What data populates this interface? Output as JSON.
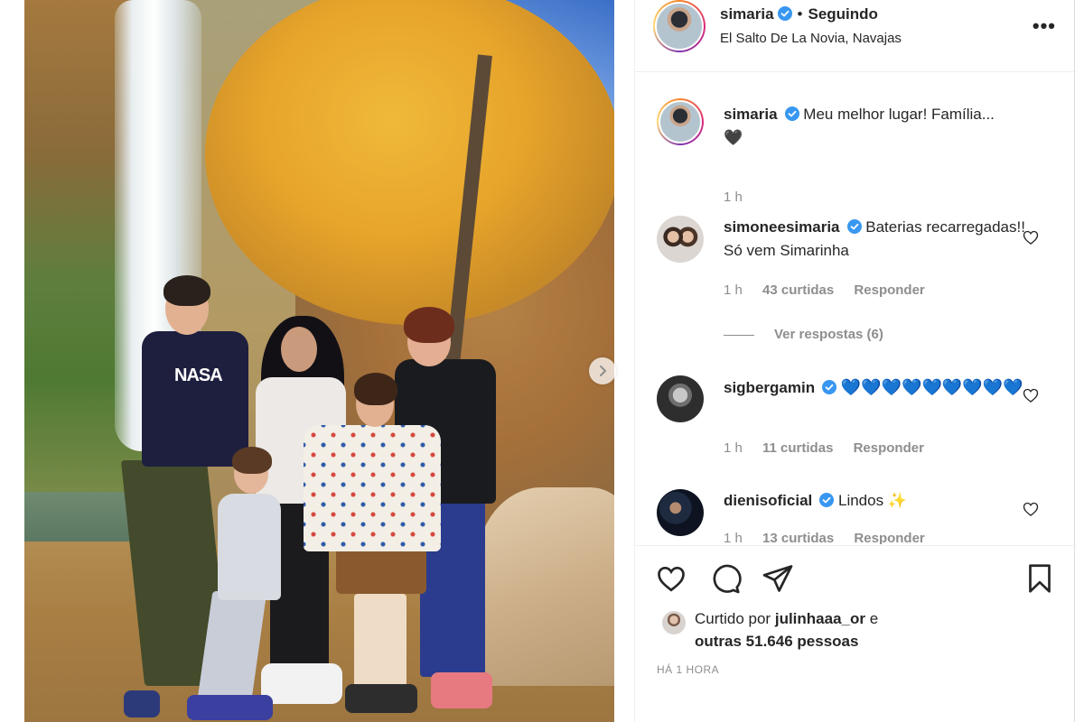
{
  "post": {
    "author": {
      "username": "simaria",
      "follow_status": "Seguindo",
      "location": "El Salto De La Novia, Navajas"
    },
    "photo": {
      "shirt_logo": "NASA"
    },
    "caption": {
      "username": "simaria",
      "text": "Meu melhor lugar! Família...",
      "second_line": "🖤",
      "time": "1 h"
    },
    "comments": [
      {
        "username": "simoneesimaria",
        "text": "Baterias recarregadas!! Só vem Simarinha",
        "time": "1 h",
        "likes": "43 curtidas",
        "reply_label": "Responder",
        "view_replies": "Ver respostas (6)"
      },
      {
        "username": "sigbergamin",
        "text": "💙💙💙💙💙💙💙💙💙",
        "time": "1 h",
        "likes": "11 curtidas",
        "reply_label": "Responder"
      },
      {
        "username": "dienisoficial",
        "text": "Lindos ✨",
        "time": "1 h",
        "likes": "13 curtidas",
        "reply_label": "Responder"
      }
    ],
    "liked_by": {
      "prefix": "Curtido por",
      "user": "julinhaaa_or",
      "suffix": "e",
      "others": "outras 51.646 pessoas"
    },
    "timestamp": "HÁ 1 HORA"
  },
  "colors": {
    "verified": "#3897f0",
    "text": "#262626",
    "muted": "#8e8e8e",
    "blue_heart": "#1877f2"
  },
  "icons": {
    "like": "heart-outline-icon",
    "comment": "speech-bubble-icon",
    "share": "paper-plane-icon",
    "save": "bookmark-icon",
    "more": "more-dots-icon",
    "next": "chevron-right-icon",
    "verified": "verified-badge-icon",
    "comment_like": "heart-outline-icon"
  }
}
